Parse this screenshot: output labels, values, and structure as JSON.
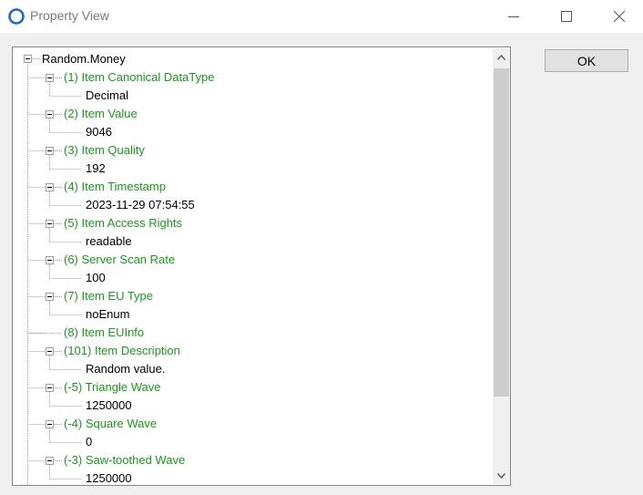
{
  "window": {
    "title": "Property View",
    "minimize_icon": "minimize-icon",
    "maximize_icon": "maximize-icon",
    "close_icon": "close-icon"
  },
  "colors": {
    "property_text": "#1a9a1a",
    "value_text": "#000000",
    "app_icon": "#1e6ec8"
  },
  "buttons": {
    "ok_label": "OK"
  },
  "tree": {
    "root": "Random.Money",
    "properties": [
      {
        "label": "(1) Item Canonical DataType",
        "value": "Decimal"
      },
      {
        "label": "(2) Item Value",
        "value": "9046"
      },
      {
        "label": "(3) Item Quality",
        "value": "192"
      },
      {
        "label": "(4) Item Timestamp",
        "value": "2023-11-29 07:54:55"
      },
      {
        "label": "(5) Item Access Rights",
        "value": "readable"
      },
      {
        "label": "(6) Server Scan Rate",
        "value": "100"
      },
      {
        "label": "(7) Item EU Type",
        "value": "noEnum"
      },
      {
        "label": "(8) Item EUInfo",
        "value": null
      },
      {
        "label": "(101) Item Description",
        "value": "Random value."
      },
      {
        "label": "(-5) Triangle Wave",
        "value": "1250000"
      },
      {
        "label": "(-4) Square Wave",
        "value": "0"
      },
      {
        "label": "(-3) Saw-toothed Wave",
        "value": "1250000"
      }
    ]
  }
}
